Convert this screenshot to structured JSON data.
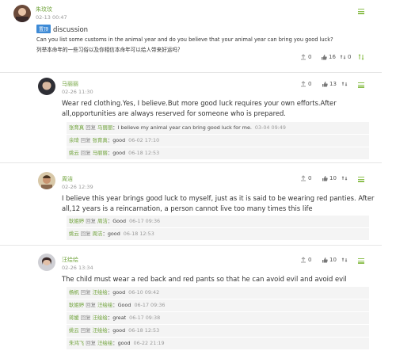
{
  "post": {
    "user": "朱玟玟",
    "date": "02-13 00:47",
    "tag": "置顶",
    "title": "discussion",
    "question_en": "Can you list some customs in the animal year and do you believe that your animal year can bring you good luck?",
    "question_zh": "列举本命年的一些习俗以及你相信本命年可以给人带来好运吗？",
    "stats": {
      "shares": "0",
      "likes": "16",
      "extra": "0"
    }
  },
  "comments": [
    {
      "user": "马丽丽",
      "date": "02-26 11:30",
      "likes": "0",
      "thumbs": "13",
      "text": "Wear red clothing.Yes, I believe.But more good luck requires your own efforts.After all,opportunities are always reserved for someone who is prepared.",
      "replies": [
        {
          "user": "张育真",
          "verb": "回复",
          "target": "马丽丽",
          "text": "I believe my animal year can bring good luck for me.",
          "date": "03-04 09:49"
        },
        {
          "user": "余琦",
          "verb": "回复",
          "target": "张育真",
          "text": "good",
          "date": "06-02 17:10"
        },
        {
          "user": "姚云",
          "verb": "回复",
          "target": "马丽丽",
          "text": "good",
          "date": "06-18 12:53"
        }
      ]
    },
    {
      "user": "周洁",
      "date": "02-26 12:39",
      "likes": "0",
      "thumbs": "10",
      "text": "I believe this year brings good luck to myself, just as it is said to be wearing red panties. After all,12 years is a reincarnation, a person cannot live too many times this life",
      "replies": [
        {
          "user": "耿姐婷",
          "verb": "回复",
          "target": "周洁",
          "text": "Good",
          "date": "06-17 09:36"
        },
        {
          "user": "姚云",
          "verb": "回复",
          "target": "周洁",
          "text": "good",
          "date": "06-18 12:53"
        }
      ]
    },
    {
      "user": "汪绘绘",
      "date": "02-26 13:34",
      "likes": "0",
      "thumbs": "10",
      "text": "The child must wear a red back and red pants so that he can avoid evil and avoid evil",
      "replies": [
        {
          "user": "杨帆",
          "verb": "回复",
          "target": "汪绘绘",
          "text": "good",
          "date": "06-10 09:42"
        },
        {
          "user": "耿姐婷",
          "verb": "回复",
          "target": "汪绘绘",
          "text": "Good",
          "date": "06-17 09:36"
        },
        {
          "user": "蒋媛",
          "verb": "回复",
          "target": "汪绘绘",
          "text": "great",
          "date": "06-17 09:38"
        },
        {
          "user": "姚云",
          "verb": "回复",
          "target": "汪绘绘",
          "text": "good",
          "date": "06-18 12:53"
        },
        {
          "user": "朱鸿飞",
          "verb": "回复",
          "target": "汪绘绘",
          "text": "good",
          "date": "06-22 21:19"
        }
      ]
    }
  ],
  "colors": {
    "accent": "#6fa23a",
    "tag_bg": "#3d8ad6",
    "reply_bg": "#f4f4f4",
    "menu": "#8cbf4e"
  },
  "icons": {
    "share": "share-icon",
    "like": "thumbs-up-icon",
    "extra": "sort-icon",
    "menu": "menu-icon"
  }
}
